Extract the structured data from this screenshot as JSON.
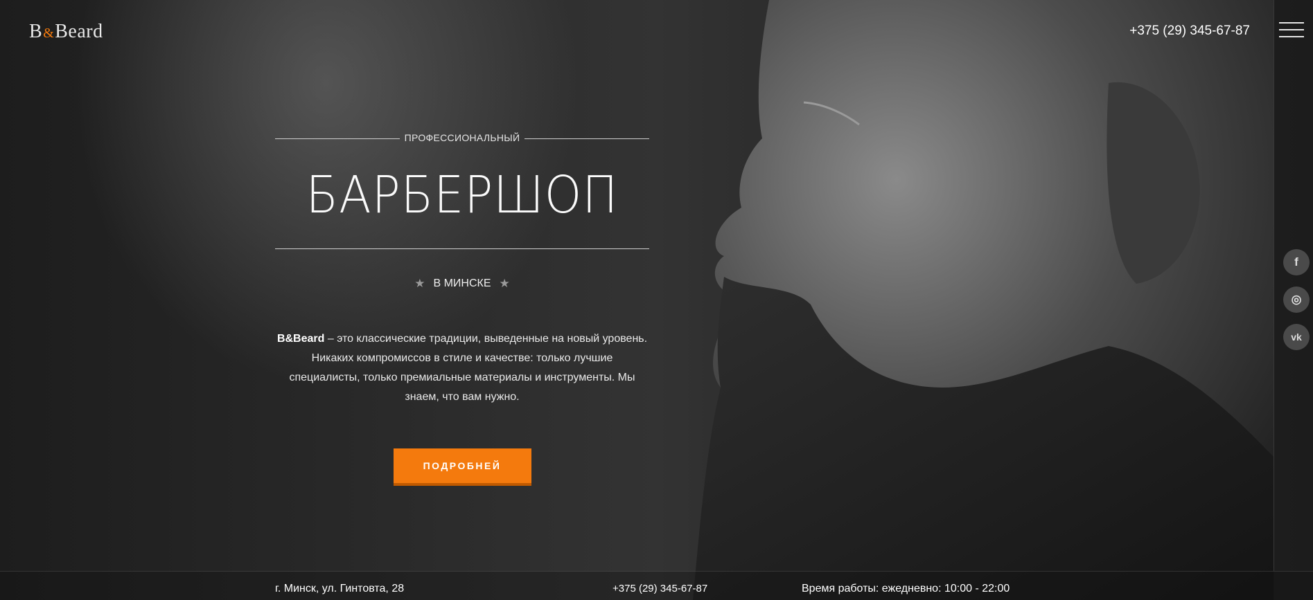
{
  "brand": {
    "logo_left": "B",
    "logo_amp": "&",
    "logo_right": "Beard"
  },
  "header": {
    "phone": "+375 (29) 345-67-87"
  },
  "hero": {
    "eyebrow": "ПРОФЕССИОНАЛЬНЫЙ",
    "title": "БАРБЕРШОП",
    "city": "В МИНСКЕ",
    "brand_bold": "B&Beard",
    "description": " – это классические традиции, выведенные на новый уровень. Никаких компромиссов в стиле и качестве: только лучшие специалисты, только премиальные материалы и инструменты. Мы знаем, что вам нужно.",
    "cta_label": "ПОДРОБНЕЙ"
  },
  "socials": [
    {
      "icon": "facebook-icon",
      "glyph": "f"
    },
    {
      "icon": "instagram-icon",
      "glyph": "◎"
    },
    {
      "icon": "vk-icon",
      "glyph": "vk"
    }
  ],
  "footer": {
    "address": "г. Минск, ул. Гинтовта, 28",
    "phone": "+375 (29) 345-67-87",
    "hours": "Время работы: ежедневно: 10:00 - 22:00"
  },
  "colors": {
    "accent": "#f47a0d",
    "background": "#1a1a1a"
  }
}
